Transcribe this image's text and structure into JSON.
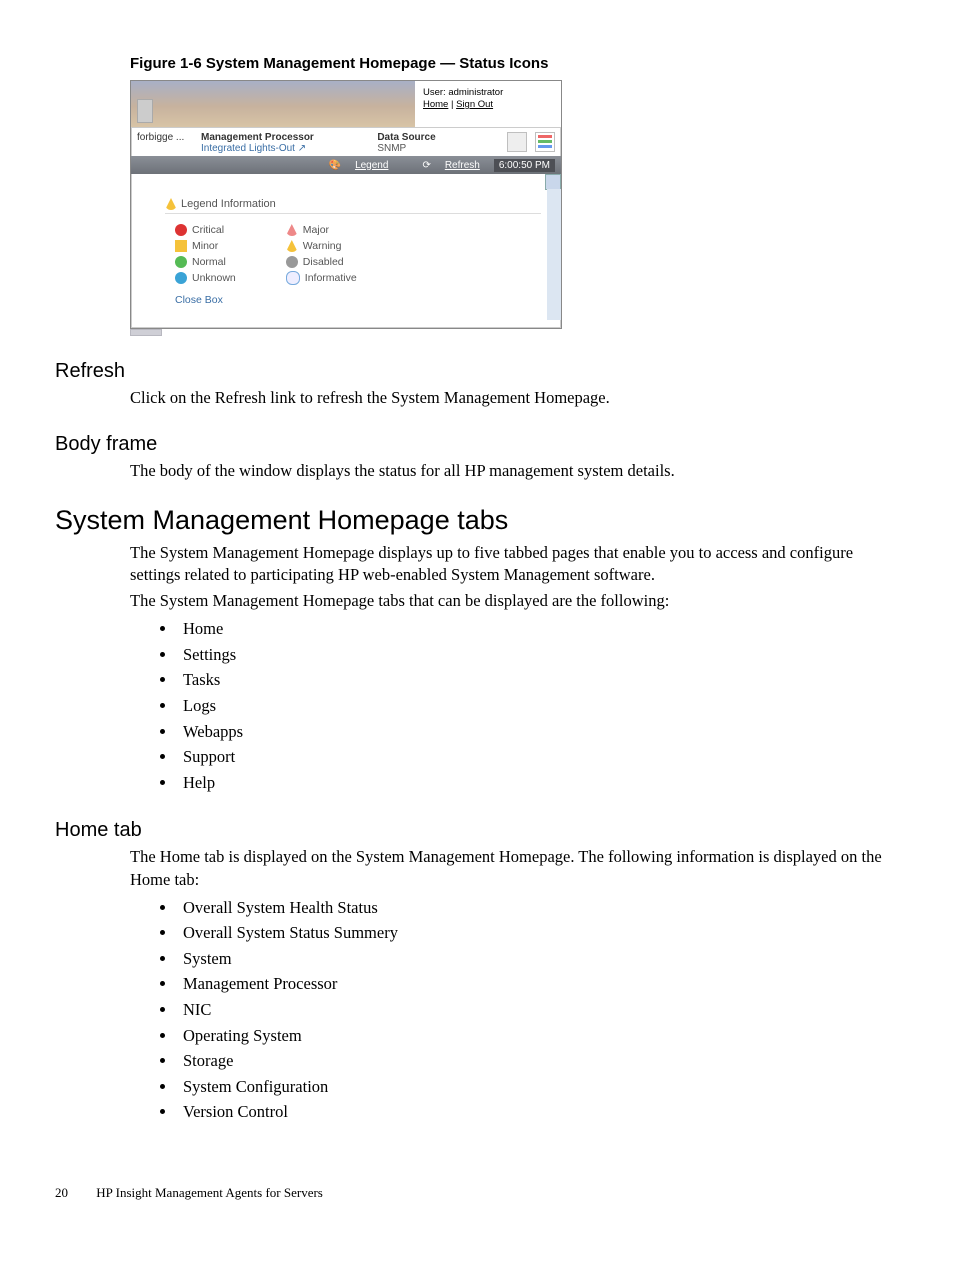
{
  "figure": {
    "caption": "Figure 1-6 System Management Homepage — Status Icons",
    "user_label": "User: administrator",
    "home_link": "Home",
    "signout_link": "Sign Out",
    "col_name": "forbigge ...",
    "mp_head": "Management Processor",
    "mp_val": "Integrated Lights-Out ↗",
    "ds_head": "Data Source",
    "ds_val": "SNMP",
    "bar_legend": "Legend",
    "bar_refresh": "Refresh",
    "bar_time": "6:00:50 PM",
    "legend_title": "Legend Information",
    "col1": {
      "a": "Critical",
      "b": "Minor",
      "c": "Normal",
      "d": "Unknown"
    },
    "col2": {
      "a": "Major",
      "b": "Warning",
      "c": "Disabled",
      "d": "Informative"
    },
    "close": "Close Box"
  },
  "refresh": {
    "head": "Refresh",
    "body": "Click on the Refresh link to refresh the System Management Homepage."
  },
  "bodyframe": {
    "head": "Body frame",
    "body": "The body of the window displays the status for all HP management system details."
  },
  "tabs": {
    "head": "System Management Homepage tabs",
    "p1": "The System Management Homepage displays up to five tabbed pages that enable you to access and configure settings related to participating HP web-enabled System Management software.",
    "p2": "The System Management Homepage tabs that can be displayed are the following:",
    "items": [
      "Home",
      "Settings",
      "Tasks",
      "Logs",
      "Webapps",
      "Support",
      "Help"
    ]
  },
  "home": {
    "head": "Home tab",
    "p1": "The Home tab is displayed on the System Management Homepage. The following information is displayed on the Home tab:",
    "items": [
      "Overall System Health Status",
      "Overall System Status Summery",
      "System",
      "Management Processor",
      "NIC",
      "Operating System",
      "Storage",
      "System Configuration",
      "Version Control"
    ]
  },
  "footer": {
    "pagenum": "20",
    "title": "HP Insight Management Agents for Servers"
  }
}
